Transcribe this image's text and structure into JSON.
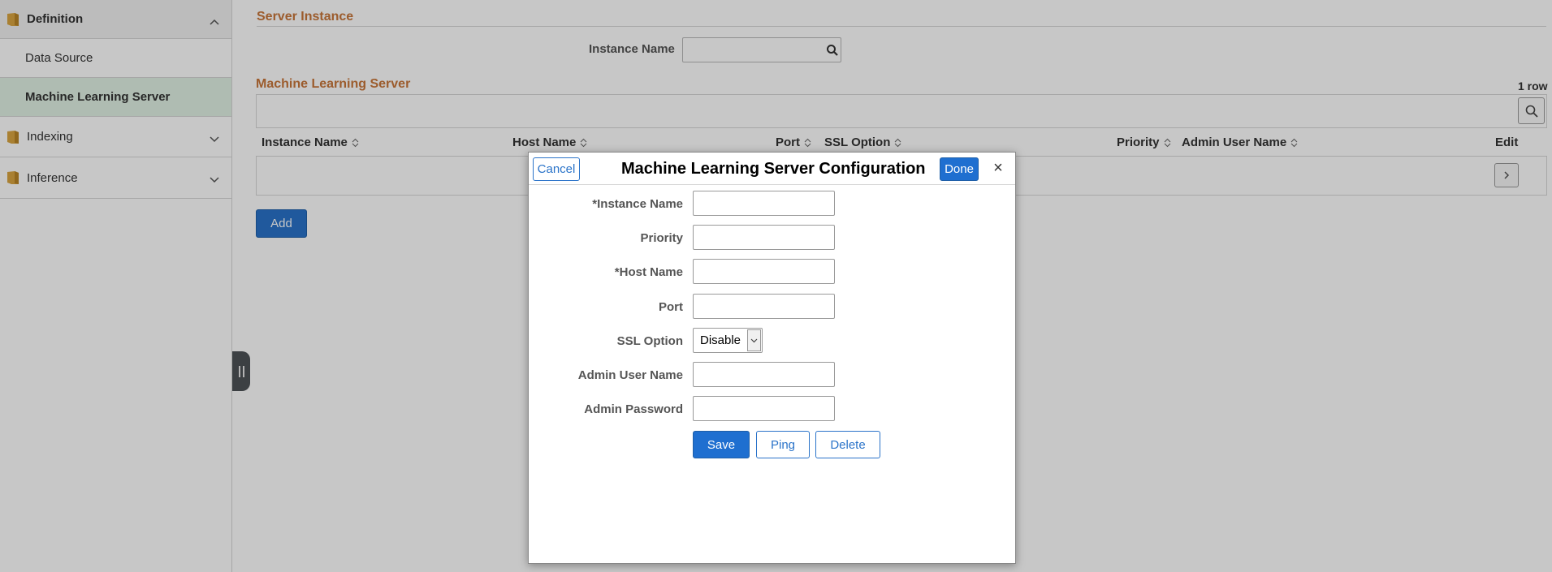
{
  "sidebar": {
    "sections": [
      {
        "label": "Definition",
        "expanded": true,
        "items": [
          "Data Source",
          "Machine Learning Server"
        ],
        "selected": "Machine Learning Server"
      },
      {
        "label": "Indexing",
        "expanded": false
      },
      {
        "label": "Inference",
        "expanded": false
      }
    ]
  },
  "main": {
    "server_instance": {
      "title": "Server Instance",
      "instance_name_label": "Instance Name",
      "instance_name_value": ""
    },
    "ml_server_grid": {
      "title": "Machine Learning Server",
      "row_count": "1 row",
      "columns": [
        "Instance Name",
        "Host Name",
        "Port",
        "SSL Option",
        "Priority",
        "Admin User Name",
        "Edit"
      ],
      "rows": [
        {
          "instance_name": "",
          "host_name": "",
          "port": "",
          "ssl_option": "",
          "priority": "",
          "admin_user_name": ""
        }
      ]
    },
    "add_label": "Add"
  },
  "modal": {
    "title": "Machine Learning Server Configuration",
    "cancel_label": "Cancel",
    "done_label": "Done",
    "close_icon": "×",
    "fields": {
      "instance_name": {
        "label": "*Instance Name",
        "value": ""
      },
      "priority": {
        "label": "Priority",
        "value": ""
      },
      "host_name": {
        "label": "*Host Name",
        "value": ""
      },
      "port": {
        "label": "Port",
        "value": ""
      },
      "ssl_option": {
        "label": "SSL Option",
        "value": "Disable"
      },
      "admin_user_name": {
        "label": "Admin User Name",
        "value": ""
      },
      "admin_password": {
        "label": "Admin Password",
        "value": ""
      }
    },
    "buttons": {
      "save": "Save",
      "ping": "Ping",
      "delete": "Delete"
    }
  },
  "colors": {
    "accent_blue": "#1f6fd0",
    "group_title_orange": "#c8763a",
    "selected_nav": "#e0f1e4",
    "folder_gold": "#d9a441"
  }
}
